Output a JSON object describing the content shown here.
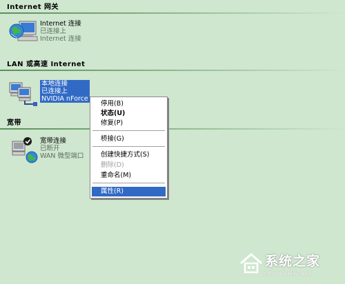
{
  "groups": {
    "internet": {
      "header": "Internet 网关",
      "item": {
        "name": "Internet 连接",
        "status": "已连接上",
        "device": "Internet 连接"
      }
    },
    "lan": {
      "header": "LAN 或高速 Internet",
      "item": {
        "name": "本地连接",
        "status": "已连接上",
        "device": "NVIDIA nForce"
      }
    },
    "broadband": {
      "header": "宽带",
      "item": {
        "name": "宽带连接",
        "status": "已断开",
        "device": "WAN 微型端口"
      }
    }
  },
  "context_menu": {
    "items": [
      {
        "label": "停用(B)"
      },
      {
        "label": "状态(U)"
      },
      {
        "label": "修复(P)"
      },
      {
        "label": "桥接(G)"
      },
      {
        "label": "创建快捷方式(S)"
      },
      {
        "label": "删除(D)"
      },
      {
        "label": "重命名(M)"
      },
      {
        "label": "属性(R)"
      }
    ],
    "default_item": "状态(U)",
    "disabled_item": "删除(D)",
    "highlighted_item": "属性(R)"
  },
  "watermark": {
    "brand": "系统之家",
    "url": "XITONGZHIJIA.NET"
  },
  "colors": {
    "background": "#cfe6cf",
    "selection": "#316ac5",
    "group_rule": "#5a8f5a"
  },
  "icons": {
    "internet": "internet-gateway-icon",
    "lan": "lan-connection-icon",
    "broadband": "broadband-disconnected-icon"
  }
}
